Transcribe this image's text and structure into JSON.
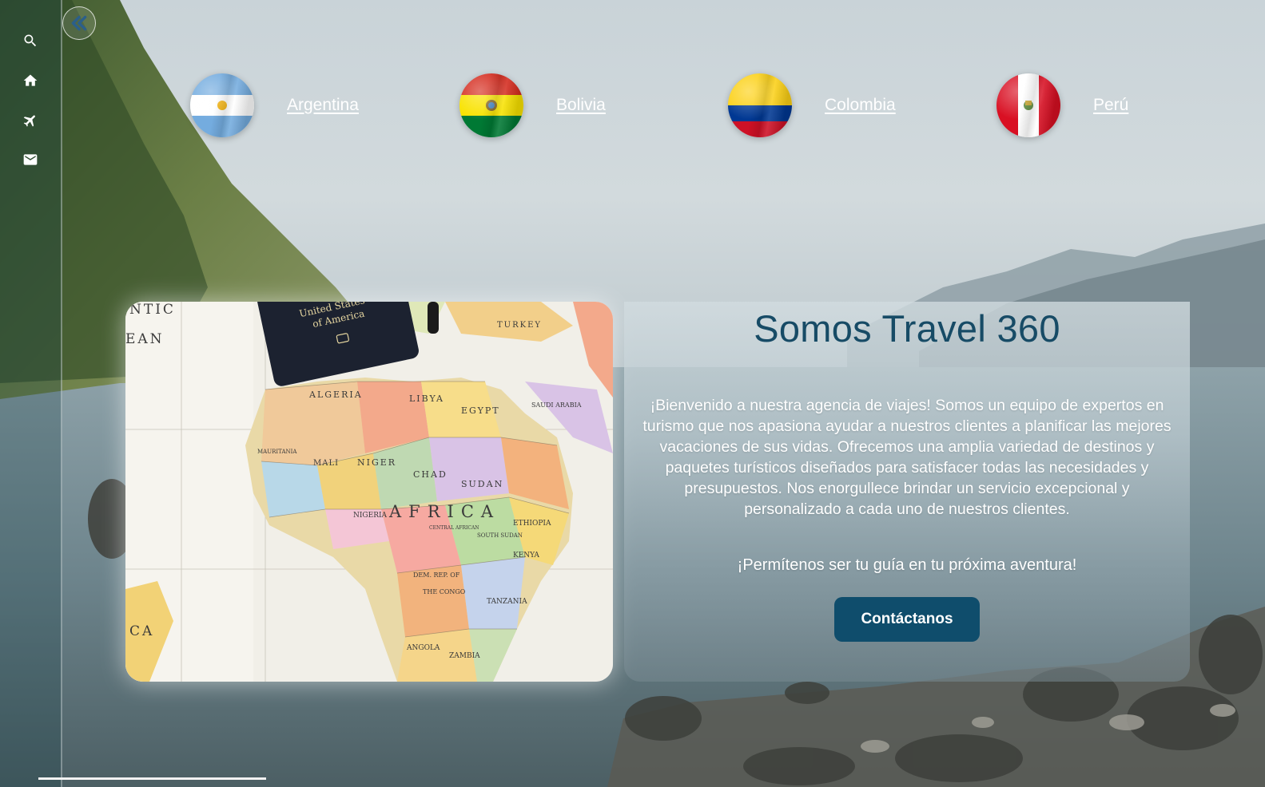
{
  "sidebar": {
    "items": [
      {
        "name": "search",
        "icon": "search-icon"
      },
      {
        "name": "home",
        "icon": "home-icon"
      },
      {
        "name": "flights",
        "icon": "airplane-icon"
      },
      {
        "name": "contact",
        "icon": "mail-icon"
      }
    ],
    "collapse_icon": "double-chevron-left-icon"
  },
  "countries": [
    {
      "label": "Argentina",
      "flag": "argentina-flag"
    },
    {
      "label": "Bolivia",
      "flag": "bolivia-flag"
    },
    {
      "label": "Colombia",
      "flag": "colombia-flag"
    },
    {
      "label": "Perú",
      "flag": "peru-flag"
    }
  ],
  "hero": {
    "title": "Somos Travel 360",
    "body": "¡Bienvenido a nuestra agencia de viajes! Somos un equipo de expertos en turismo que nos apasiona ayudar a nuestros clientes a planificar las mejores vacaciones de sus vidas. Ofrecemos una amplia variedad de destinos y paquetes turísticos diseñados para satisfacer todas las necesidades y presupuestos. Nos enorgullece brindar un servicio excepcional y personalizado a cada uno de nuestros clientes.",
    "tagline": "¡Permítenos ser tu guía en tu próxima aventura!",
    "cta_label": "Contáctanos"
  },
  "map_image": {
    "passport_line1": "United States",
    "passport_line2": "of America",
    "labels": [
      "AFRICA",
      "ALGERIA",
      "LIBYA",
      "EGYPT",
      "SUDAN",
      "CHAD",
      "NIGER",
      "MALI",
      "MAURITANIA",
      "NIGERIA",
      "ETHIOPIA",
      "KENYA",
      "TANZANIA",
      "ANGOLA",
      "ZAMBIA",
      "TURKEY",
      "SAUDI ARABIA",
      "DEM. REP. OF THE CONGO",
      "SOUTH SUDAN",
      "CENTRAL AFRICAN REPUBLIC",
      "NTIC",
      "EAN",
      "CA"
    ]
  },
  "colors": {
    "title": "#174b66",
    "cta_background": "#0f4d6c",
    "text": "#ffffff"
  }
}
